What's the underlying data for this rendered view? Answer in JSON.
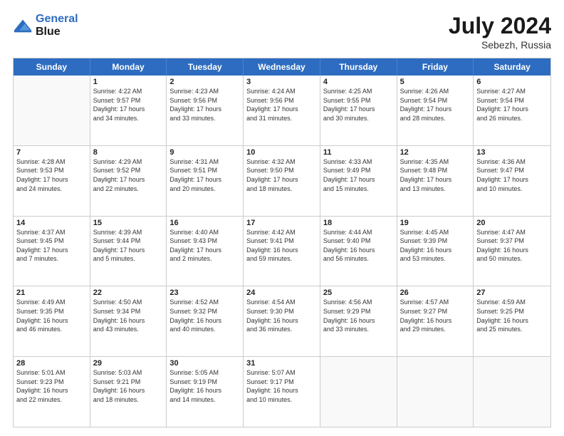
{
  "header": {
    "logo_line1": "General",
    "logo_line2": "Blue",
    "month_year": "July 2024",
    "location": "Sebezh, Russia"
  },
  "weekdays": [
    "Sunday",
    "Monday",
    "Tuesday",
    "Wednesday",
    "Thursday",
    "Friday",
    "Saturday"
  ],
  "rows": [
    [
      {
        "day": "",
        "info": ""
      },
      {
        "day": "1",
        "info": "Sunrise: 4:22 AM\nSunset: 9:57 PM\nDaylight: 17 hours\nand 34 minutes."
      },
      {
        "day": "2",
        "info": "Sunrise: 4:23 AM\nSunset: 9:56 PM\nDaylight: 17 hours\nand 33 minutes."
      },
      {
        "day": "3",
        "info": "Sunrise: 4:24 AM\nSunset: 9:56 PM\nDaylight: 17 hours\nand 31 minutes."
      },
      {
        "day": "4",
        "info": "Sunrise: 4:25 AM\nSunset: 9:55 PM\nDaylight: 17 hours\nand 30 minutes."
      },
      {
        "day": "5",
        "info": "Sunrise: 4:26 AM\nSunset: 9:54 PM\nDaylight: 17 hours\nand 28 minutes."
      },
      {
        "day": "6",
        "info": "Sunrise: 4:27 AM\nSunset: 9:54 PM\nDaylight: 17 hours\nand 26 minutes."
      }
    ],
    [
      {
        "day": "7",
        "info": "Sunrise: 4:28 AM\nSunset: 9:53 PM\nDaylight: 17 hours\nand 24 minutes."
      },
      {
        "day": "8",
        "info": "Sunrise: 4:29 AM\nSunset: 9:52 PM\nDaylight: 17 hours\nand 22 minutes."
      },
      {
        "day": "9",
        "info": "Sunrise: 4:31 AM\nSunset: 9:51 PM\nDaylight: 17 hours\nand 20 minutes."
      },
      {
        "day": "10",
        "info": "Sunrise: 4:32 AM\nSunset: 9:50 PM\nDaylight: 17 hours\nand 18 minutes."
      },
      {
        "day": "11",
        "info": "Sunrise: 4:33 AM\nSunset: 9:49 PM\nDaylight: 17 hours\nand 15 minutes."
      },
      {
        "day": "12",
        "info": "Sunrise: 4:35 AM\nSunset: 9:48 PM\nDaylight: 17 hours\nand 13 minutes."
      },
      {
        "day": "13",
        "info": "Sunrise: 4:36 AM\nSunset: 9:47 PM\nDaylight: 17 hours\nand 10 minutes."
      }
    ],
    [
      {
        "day": "14",
        "info": "Sunrise: 4:37 AM\nSunset: 9:45 PM\nDaylight: 17 hours\nand 7 minutes."
      },
      {
        "day": "15",
        "info": "Sunrise: 4:39 AM\nSunset: 9:44 PM\nDaylight: 17 hours\nand 5 minutes."
      },
      {
        "day": "16",
        "info": "Sunrise: 4:40 AM\nSunset: 9:43 PM\nDaylight: 17 hours\nand 2 minutes."
      },
      {
        "day": "17",
        "info": "Sunrise: 4:42 AM\nSunset: 9:41 PM\nDaylight: 16 hours\nand 59 minutes."
      },
      {
        "day": "18",
        "info": "Sunrise: 4:44 AM\nSunset: 9:40 PM\nDaylight: 16 hours\nand 56 minutes."
      },
      {
        "day": "19",
        "info": "Sunrise: 4:45 AM\nSunset: 9:39 PM\nDaylight: 16 hours\nand 53 minutes."
      },
      {
        "day": "20",
        "info": "Sunrise: 4:47 AM\nSunset: 9:37 PM\nDaylight: 16 hours\nand 50 minutes."
      }
    ],
    [
      {
        "day": "21",
        "info": "Sunrise: 4:49 AM\nSunset: 9:35 PM\nDaylight: 16 hours\nand 46 minutes."
      },
      {
        "day": "22",
        "info": "Sunrise: 4:50 AM\nSunset: 9:34 PM\nDaylight: 16 hours\nand 43 minutes."
      },
      {
        "day": "23",
        "info": "Sunrise: 4:52 AM\nSunset: 9:32 PM\nDaylight: 16 hours\nand 40 minutes."
      },
      {
        "day": "24",
        "info": "Sunrise: 4:54 AM\nSunset: 9:30 PM\nDaylight: 16 hours\nand 36 minutes."
      },
      {
        "day": "25",
        "info": "Sunrise: 4:56 AM\nSunset: 9:29 PM\nDaylight: 16 hours\nand 33 minutes."
      },
      {
        "day": "26",
        "info": "Sunrise: 4:57 AM\nSunset: 9:27 PM\nDaylight: 16 hours\nand 29 minutes."
      },
      {
        "day": "27",
        "info": "Sunrise: 4:59 AM\nSunset: 9:25 PM\nDaylight: 16 hours\nand 25 minutes."
      }
    ],
    [
      {
        "day": "28",
        "info": "Sunrise: 5:01 AM\nSunset: 9:23 PM\nDaylight: 16 hours\nand 22 minutes."
      },
      {
        "day": "29",
        "info": "Sunrise: 5:03 AM\nSunset: 9:21 PM\nDaylight: 16 hours\nand 18 minutes."
      },
      {
        "day": "30",
        "info": "Sunrise: 5:05 AM\nSunset: 9:19 PM\nDaylight: 16 hours\nand 14 minutes."
      },
      {
        "day": "31",
        "info": "Sunrise: 5:07 AM\nSunset: 9:17 PM\nDaylight: 16 hours\nand 10 minutes."
      },
      {
        "day": "",
        "info": ""
      },
      {
        "day": "",
        "info": ""
      },
      {
        "day": "",
        "info": ""
      }
    ]
  ]
}
